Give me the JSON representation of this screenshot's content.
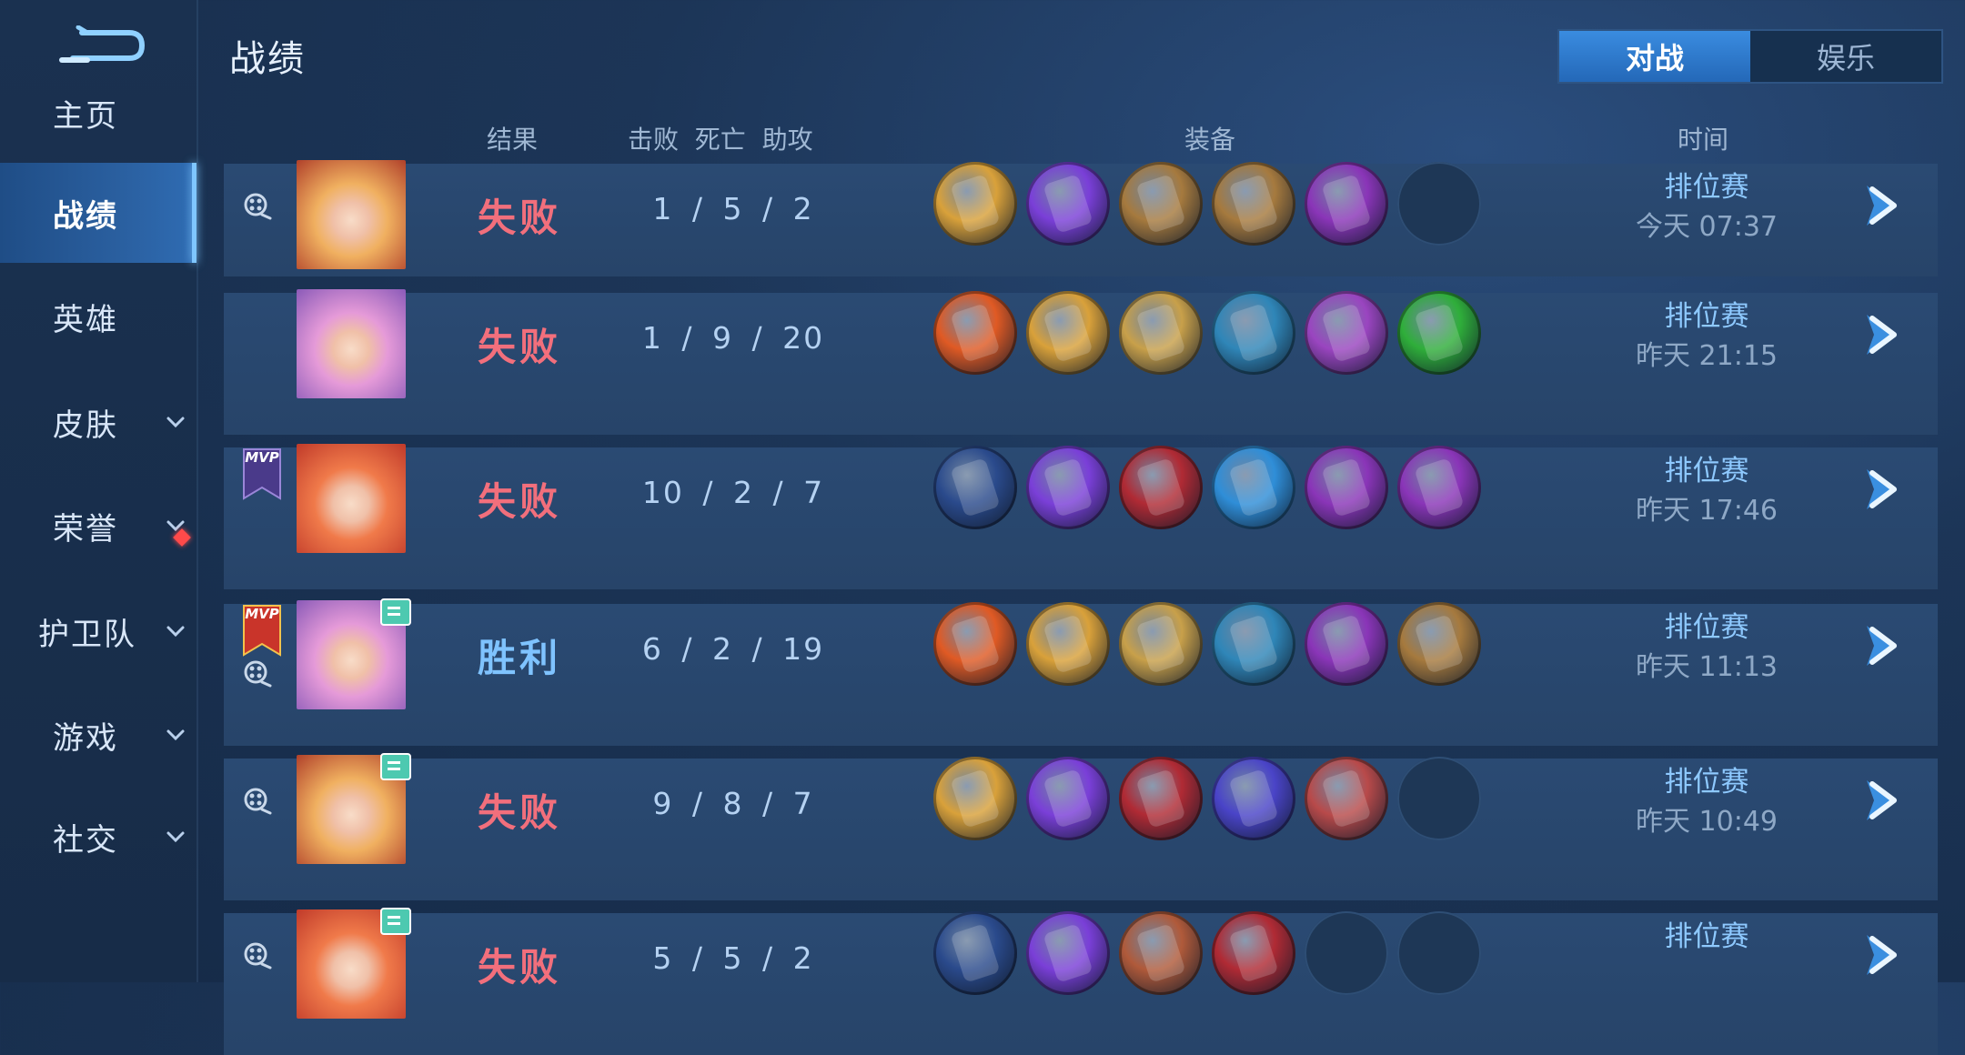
{
  "sidebar": {
    "items": [
      {
        "label": "主页",
        "active": false,
        "chevron": false
      },
      {
        "label": "战绩",
        "active": true,
        "chevron": false
      },
      {
        "label": "英雄",
        "active": false,
        "chevron": false
      },
      {
        "label": "皮肤",
        "active": false,
        "chevron": true
      },
      {
        "label": "荣誉",
        "active": false,
        "chevron": true
      },
      {
        "label": "护卫队",
        "active": false,
        "chevron": true
      },
      {
        "label": "游戏",
        "active": false,
        "chevron": true
      },
      {
        "label": "社交",
        "active": false,
        "chevron": true
      }
    ]
  },
  "header": {
    "title": "战绩",
    "tabs": [
      {
        "label": "对战",
        "active": true
      },
      {
        "label": "娱乐",
        "active": false
      }
    ]
  },
  "columns": {
    "result": "结果",
    "kda": "击败  死亡  助攻",
    "equipment": "装备",
    "time": "时间"
  },
  "matches": [
    {
      "result": "失败",
      "kda": "1 / 5 / 2",
      "mode": "排位赛",
      "time": "今天 07:37",
      "mvp": null,
      "replay": true,
      "badge": false,
      "hero_colors": [
        "#f0b060",
        "#b0402a"
      ],
      "items": [
        "#d9a13a",
        "#7a3fd8",
        "#a67a3e",
        "#a67a3e",
        "#8a35b8",
        "empty"
      ]
    },
    {
      "result": "失败",
      "kda": "1 / 9 / 20",
      "mode": "排位赛",
      "time": "昨天 21:15",
      "mvp": null,
      "replay": false,
      "badge": false,
      "hero_colors": [
        "#e59ad8",
        "#8a5ab8"
      ],
      "items": [
        "#e05a24",
        "#d9a13a",
        "#c8a04a",
        "#2f86b8",
        "#9a45c0",
        "#2fae3a"
      ]
    },
    {
      "result": "失败",
      "kda": "10 / 2 / 7",
      "mode": "排位赛",
      "time": "昨天 17:46",
      "mvp": "violet",
      "replay": false,
      "badge": false,
      "hero_colors": [
        "#f07a4a",
        "#c03a2a"
      ],
      "items": [
        "#2a4a8c",
        "#7a3fd8",
        "#b02a34",
        "#2f8ed8",
        "#8a35b8",
        "#8a35b8"
      ]
    },
    {
      "result": "胜利",
      "kda": "6 / 2 / 19",
      "mode": "排位赛",
      "time": "昨天 11:13",
      "mvp": "gold",
      "replay": true,
      "badge": true,
      "hero_colors": [
        "#e59ad8",
        "#8a5ab8"
      ],
      "items": [
        "#e05a24",
        "#d9a13a",
        "#c8a04a",
        "#2f86b8",
        "#8a35b8",
        "#a67a3e"
      ]
    },
    {
      "result": "失败",
      "kda": "9 / 8 / 7",
      "mode": "排位赛",
      "time": "昨天 10:49",
      "mvp": null,
      "replay": true,
      "badge": true,
      "hero_colors": [
        "#f0b060",
        "#b0402a"
      ],
      "items": [
        "#d9a13a",
        "#7a3fd8",
        "#b02a34",
        "#4a44c8",
        "#b84a4a",
        "empty"
      ]
    },
    {
      "result": "失败",
      "kda": "5 / 5 / 2",
      "mode": "排位赛",
      "time": "",
      "mvp": null,
      "replay": true,
      "badge": true,
      "hero_colors": [
        "#f07a4a",
        "#c03a2a"
      ],
      "items": [
        "#2a4a8c",
        "#7a3fd8",
        "#b05a3a",
        "#b02a34",
        "empty",
        "empty"
      ]
    }
  ],
  "colors": {
    "lose": "#f26f7c",
    "win": "#7fc3ff",
    "accent": "#3a8ce0"
  }
}
